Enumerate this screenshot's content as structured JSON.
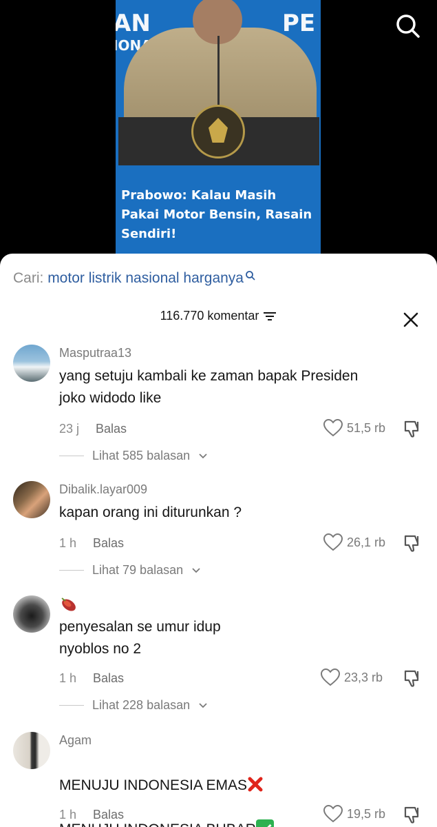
{
  "video": {
    "caption": "Prabowo: Kalau Masih Pakai Motor Bensin, Rasain Sendiri!",
    "bg_left": "AN",
    "bg_left2": "IONA",
    "bg_right": "PE"
  },
  "search_suggestion": {
    "prefix": "Cari:",
    "query": "motor listrik nasional harganya"
  },
  "comments_header": {
    "count_label": "116.770 komentar"
  },
  "comments": [
    {
      "username": "Masputraa13",
      "text": "yang setuju kambali ke zaman bapak Presiden\njoko widodo like",
      "time": "23 j",
      "reply_label": "Balas",
      "likes": "51,5 rb",
      "view_replies": "Lihat 585 balasan"
    },
    {
      "username": "Dibalik.layar009",
      "text": "kapan orang ini diturunkan ?",
      "time": "1 h",
      "reply_label": "Balas",
      "likes": "26,1 rb",
      "view_replies": "Lihat 79 balasan"
    },
    {
      "username": "",
      "text": "penyesalan se umur idup\nnyoblos no 2",
      "time": "1 h",
      "reply_label": "Balas",
      "likes": "23,3 rb",
      "view_replies": "Lihat 228 balasan"
    },
    {
      "username": "Agam",
      "line1": "MENUJU INDONESIA EMAS",
      "line2": "MENUJU INDONESIA BUBAR",
      "time": "1 h",
      "reply_label": "Balas",
      "likes": "19,5 rb"
    }
  ],
  "colors": {
    "accent_query": "#2f5ea0",
    "video_bg": "#1a6fc0"
  }
}
